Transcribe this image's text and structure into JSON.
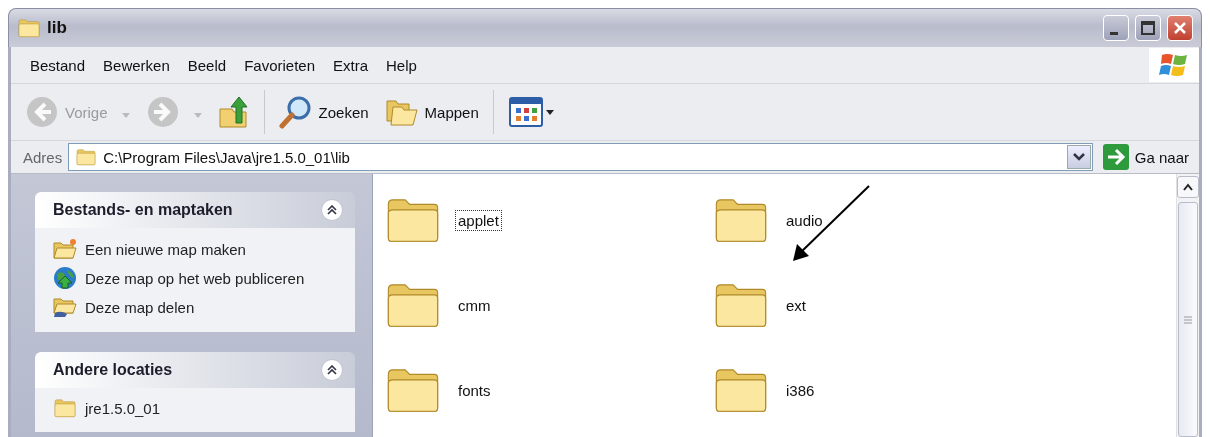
{
  "window": {
    "title": "lib"
  },
  "menu": [
    {
      "label": "Bestand"
    },
    {
      "label": "Bewerken"
    },
    {
      "label": "Beeld"
    },
    {
      "label": "Favorieten"
    },
    {
      "label": "Extra"
    },
    {
      "label": "Help"
    }
  ],
  "toolbar": [
    {
      "kind": "back",
      "label": "Vorige",
      "disabled": true
    },
    {
      "kind": "forward",
      "disabled": true
    },
    {
      "kind": "up",
      "disabled": false
    },
    {
      "kind": "search",
      "label": "Zoeken",
      "disabled": false
    },
    {
      "kind": "folders",
      "label": "Mappen",
      "disabled": false
    },
    {
      "kind": "views",
      "disabled": false
    }
  ],
  "address": {
    "label": "Adres",
    "value": "C:\\Program Files\\Java\\jre1.5.0_01\\lib",
    "go_label": "Ga naar"
  },
  "sidebar": {
    "panels": [
      {
        "title": "Bestands- en maptaken",
        "expanded": true,
        "items": [
          {
            "kind": "new-folder",
            "label": "Een nieuwe map maken"
          },
          {
            "kind": "publish",
            "label": "Deze map op het web publiceren"
          },
          {
            "kind": "share",
            "label": "Deze map delen"
          }
        ]
      },
      {
        "title": "Andere locaties",
        "expanded": true,
        "items": [
          {
            "kind": "folder",
            "label": "jre1.5.0_01"
          }
        ]
      }
    ]
  },
  "folders": [
    {
      "name": "applet",
      "focused": true
    },
    {
      "name": "audio",
      "focused": false
    },
    {
      "name": "cmm",
      "focused": false
    },
    {
      "name": "ext",
      "focused": false
    },
    {
      "name": "fonts",
      "focused": false
    },
    {
      "name": "i386",
      "focused": false
    }
  ]
}
